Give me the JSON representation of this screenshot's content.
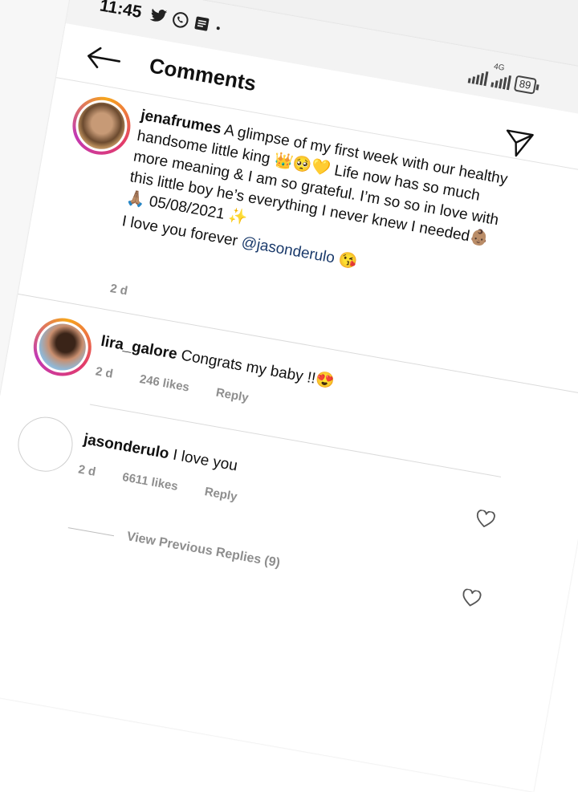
{
  "status_bar": {
    "time": "11:45",
    "network": "4G",
    "battery": "89"
  },
  "header": {
    "title": "Comments"
  },
  "post": {
    "username": "jenafrumes",
    "caption": "A glimpse of my first week with our healthy handsome little king 👑🥺💛 Life now has so much more meaning & I am so grateful. I’m so so in love with this little boy he’s everything I never knew I needed👶🏽🙏🏽 05/08/2021 ✨",
    "caption_line2_prefix": "I love you forever ",
    "mention": "@jasonderulo",
    "caption_line2_suffix": " 😘",
    "age": "2 d"
  },
  "comments": [
    {
      "username": "lira_galore",
      "text": "Congrats my baby !!😍",
      "age": "2 d",
      "likes": "246 likes",
      "reply": "Reply"
    },
    {
      "username": "jasonderulo",
      "text": "I love you",
      "age": "2 d",
      "likes": "6611 likes",
      "reply": "Reply"
    }
  ],
  "view_previous": "View Previous Replies (9)",
  "icons": [
    "back-arrow-icon",
    "twitter-icon",
    "whatsapp-icon",
    "message-icon",
    "send-icon",
    "heart-icon",
    "signal-icon"
  ],
  "colors": {
    "story_ring": "#e23b6b",
    "mention": "#1a3a6b",
    "meta_gray": "#8e8e8e"
  }
}
